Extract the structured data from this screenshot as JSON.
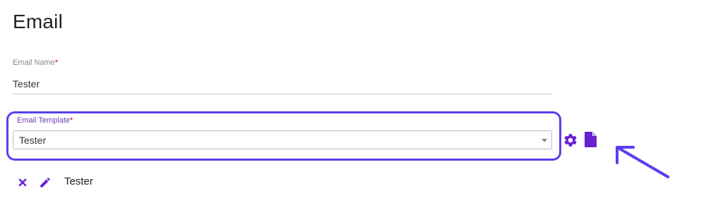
{
  "page": {
    "title": "Email"
  },
  "email_name": {
    "label": "Email Name",
    "required_mark": "*",
    "value": "Tester"
  },
  "email_template": {
    "label": "Email Template",
    "required_mark": "*",
    "selected": "Tester"
  },
  "template_actions": {
    "settings_icon": "gear-icon",
    "document_icon": "document-icon"
  },
  "selected_items": [
    {
      "label": "Tester",
      "remove_icon": "close-icon",
      "edit_icon": "pencil-icon"
    }
  ],
  "colors": {
    "accent_purple": "#6a1fd1",
    "highlight_border": "#5a3ff0",
    "annotation_arrow": "#5a3ff0",
    "required": "#d0021b"
  }
}
